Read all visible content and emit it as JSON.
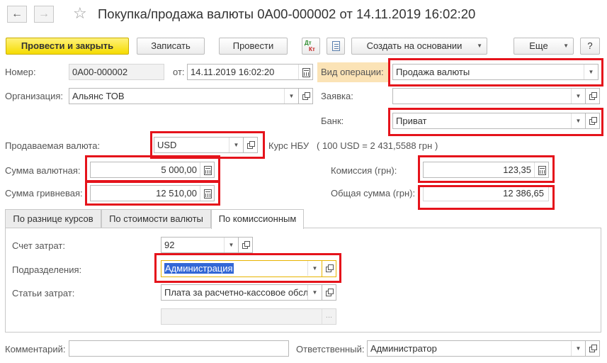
{
  "window": {
    "title": "Покупка/продажа валюты 0А00-000002 от 14.11.2019 16:02:20",
    "back_icon": "arrow-left-icon",
    "forward_icon": "arrow-right-icon",
    "favorite_icon": "star-icon"
  },
  "toolbar": {
    "post_close_label": "Провести и закрыть",
    "save_label": "Записать",
    "post_label": "Провести",
    "dtkt_icon": "dt-kt-icon",
    "report_icon": "document-icon",
    "create_based_label": "Создать на основании",
    "more_label": "Еще",
    "help_label": "?"
  },
  "header": {
    "number_label": "Номер:",
    "number_value": "0А00-000002",
    "date_label": "от:",
    "date_value": "14.11.2019 16:02:20",
    "operation_label": "Вид операции:",
    "operation_value": "Продажа валюты",
    "org_label": "Организация:",
    "org_value": "Альянс ТОВ",
    "request_label": "Заявка:",
    "request_value": "",
    "bank_label": "Банк:",
    "bank_value": "Приват"
  },
  "currency": {
    "sold_label": "Продаваемая валюта:",
    "sold_value": "USD",
    "rate_label": "Курс НБУ",
    "rate_value": "( 100 USD = 2 431,5588 грн )",
    "amount_cur_label": "Сумма валютная:",
    "amount_cur_value": "5 000,00",
    "amount_uah_label": "Сумма гривневая:",
    "amount_uah_value": "12 510,00",
    "commission_label": "Комиссия (грн):",
    "commission_value": "123,35",
    "total_label": "Общая сумма (грн):",
    "total_value": "12 386,65"
  },
  "tabs": [
    {
      "label": "По разнице курсов"
    },
    {
      "label": "По стоимости валюты"
    },
    {
      "label": "По комиссионным"
    }
  ],
  "commission_tab": {
    "account_label": "Счет затрат:",
    "account_value": "92",
    "dept_label": "Подразделения:",
    "dept_value": "Администрация",
    "cost_item_label": "Статьи затрат:",
    "cost_item_value": "Плата за расчетно-кассовое обсл",
    "extra_value": "",
    "extra_button": "..."
  },
  "footer": {
    "comment_label": "Комментарий:",
    "comment_value": "",
    "responsible_label": "Ответственный:",
    "responsible_value": "Администратор"
  },
  "colors": {
    "primary_button": "#f5dc00",
    "highlight_box": "#e5131b",
    "selection": "#3367d6",
    "operation_label_bg": "#fbe3b6"
  }
}
